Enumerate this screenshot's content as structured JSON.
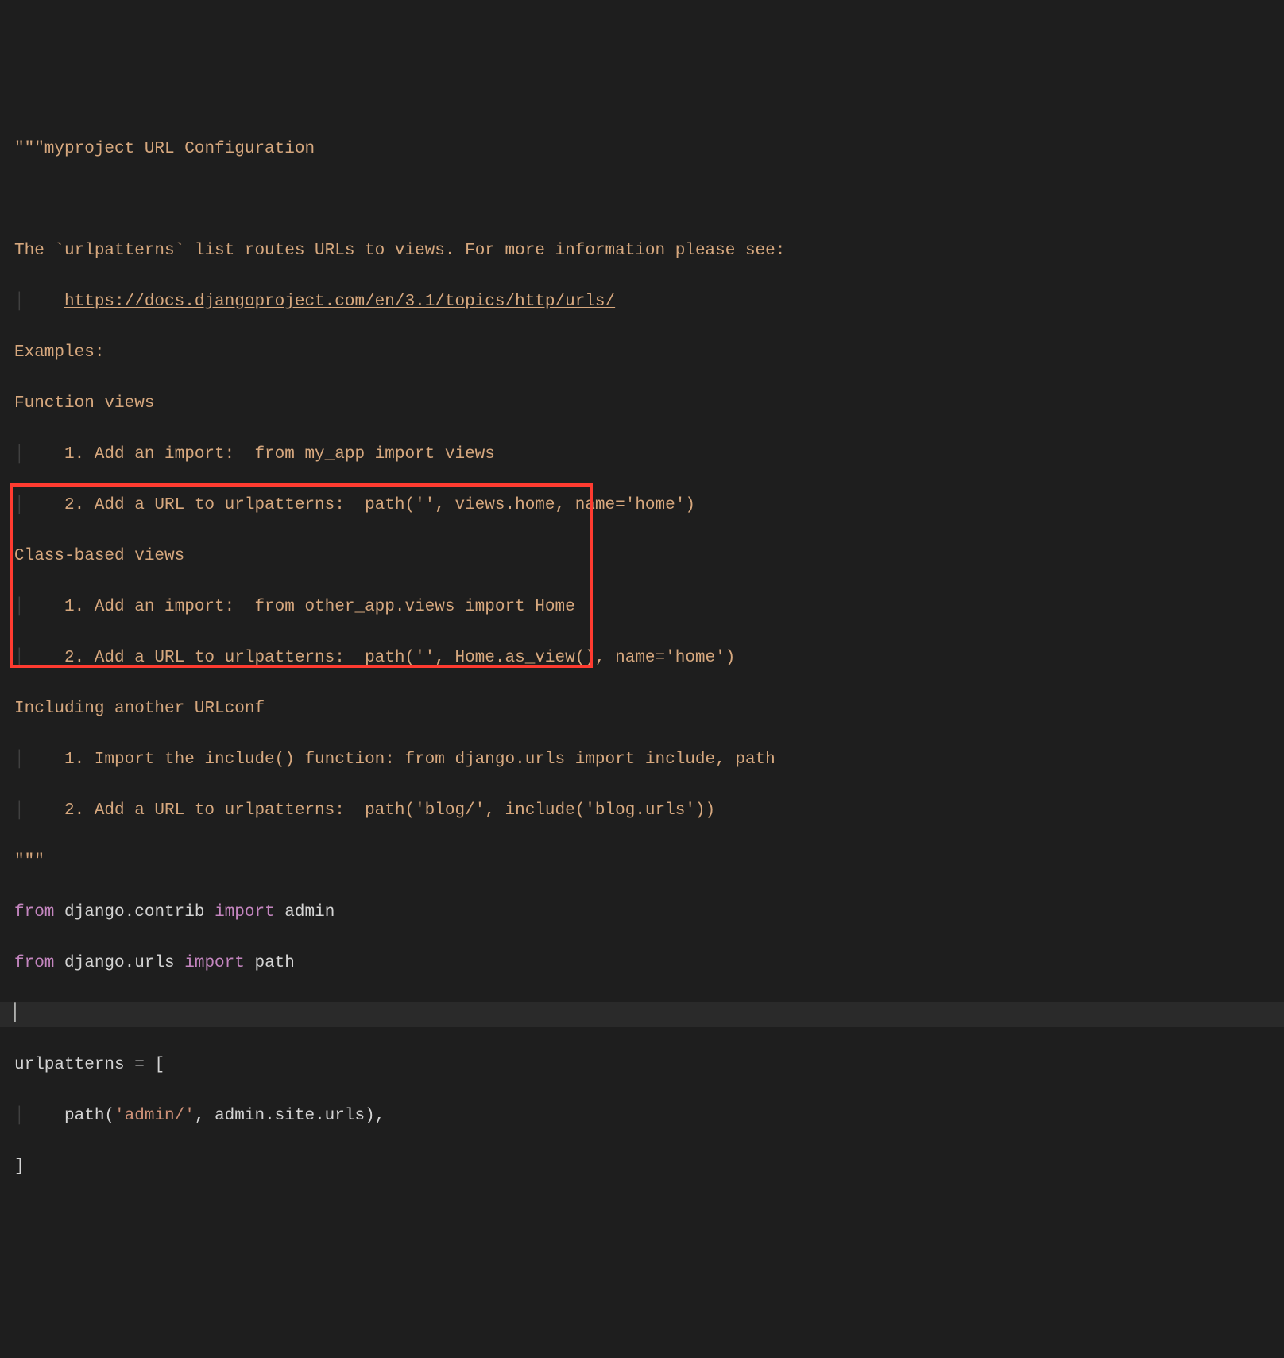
{
  "doc": {
    "l1": "\"\"\"myproject URL Configuration",
    "l2": "",
    "l3": "The `urlpatterns` list routes URLs to views. For more information please see:",
    "l4_indent": "    ",
    "l4_link": "https://docs.djangoproject.com/en/3.1/topics/http/urls/",
    "l5": "Examples:",
    "l6": "Function views",
    "l7": "    1. Add an import:  from my_app import views",
    "l8": "    2. Add a URL to urlpatterns:  path('', views.home, name='home')",
    "l9": "Class-based views",
    "l10": "    1. Add an import:  from other_app.views import Home",
    "l11": "    2. Add a URL to urlpatterns:  path('', Home.as_view(), name='home')",
    "l12": "Including another URLconf",
    "l13": "    1. Import the include() function: from django.urls import include, path",
    "l14": "    2. Add a URL to urlpatterns:  path('blog/', include('blog.urls'))",
    "l15": "\"\"\""
  },
  "code": {
    "from1": "from",
    "mod1": " django.contrib ",
    "import1": "import",
    "name1": " admin",
    "from2": "from",
    "mod2": " django.urls ",
    "import2": "import",
    "name2": " path",
    "var": "urlpatterns ",
    "eq": "= [",
    "indent": "    ",
    "pathfn": "path(",
    "str": "'admin/'",
    "rest": ", admin.site.urls),",
    "close": "]"
  },
  "guide": "│"
}
